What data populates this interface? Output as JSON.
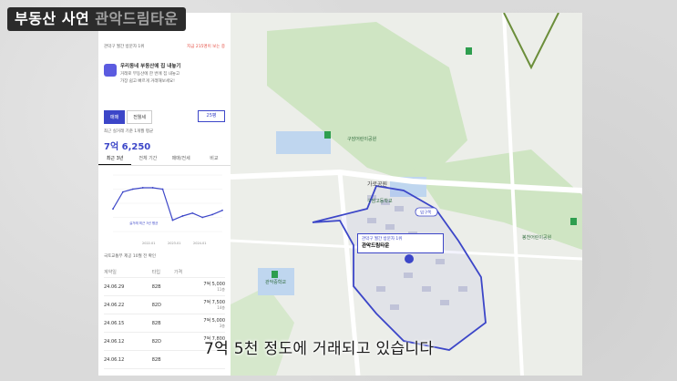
{
  "video_title": "부동산 사연",
  "video_title_suffix": "관악드림타운",
  "panel": {
    "notice_left": "관악구 월간 방문자 1위",
    "notice_right": "지금 215명이 보는 중",
    "ad_title": "우리동네 부동산에 집 내놓기",
    "ad_line1": "거래로 부동산에 한 번에 집 내놓고",
    "ad_line2": "가장 쉽고 빠르게 거래해보세요!",
    "tab_trade": "매매",
    "tab_rent": "전월세",
    "area_select": "25평",
    "price_caption": "최근 실거래 기준 1개월 평균",
    "avg_price": "7억 6,250",
    "period_tabs": [
      "최근 3년",
      "전체 기간",
      "매매/전세",
      "비교"
    ],
    "chart_label": "실거래 최근 3년 평균",
    "chart_x": [
      "2022.01",
      "2023.01",
      "2024.01"
    ],
    "trade_caption": "국토교통부 제공 10월 전 확인",
    "headers": [
      "계약일",
      "타입",
      "가격"
    ],
    "trades": [
      {
        "date": "24.06.29",
        "type": "82B",
        "price": "7억 5,000",
        "floor": "11층"
      },
      {
        "date": "24.06.22",
        "type": "82D",
        "price": "7억 7,500",
        "floor": "14층"
      },
      {
        "date": "24.06.15",
        "type": "82B",
        "price": "7억 5,000",
        "floor": "3층"
      },
      {
        "date": "24.06.12",
        "type": "82D",
        "price": "7억 7,800",
        "floor": "15층"
      },
      {
        "date": "24.06.12",
        "type": "82B",
        "price": "",
        "floor": ""
      }
    ]
  },
  "map": {
    "card_badge": "관악구 월간 방문자 1위",
    "card_name": "관악드림타운",
    "card_address": "서울특별시 관악구 봉천동 1712",
    "park_label": "가로공원",
    "labels": [
      {
        "text": "구암어린이공원"
      },
      {
        "text": "관악중학교"
      },
      {
        "text": "구암고등학교"
      },
      {
        "text": "봉천어린이공원"
      },
      {
        "text": "관악드림타운"
      },
      {
        "text": "입구쪽"
      }
    ]
  },
  "caption": "7억 5천 정도에 거래되고 있습니다",
  "chart_data": {
    "type": "line",
    "x": [
      "2021.10",
      "2022.01",
      "2022.04",
      "2022.07",
      "2022.10",
      "2023.01",
      "2023.04",
      "2023.07",
      "2023.10",
      "2024.01",
      "2024.04",
      "2024.06"
    ],
    "series": [
      {
        "values": [
          8.6,
          9.8,
          10.0,
          10.1,
          10.1,
          10.0,
          7.8,
          8.1,
          8.3,
          8.0,
          8.2,
          8.5
        ]
      }
    ],
    "ylabel": "",
    "ylim": [
      7,
      11
    ]
  }
}
